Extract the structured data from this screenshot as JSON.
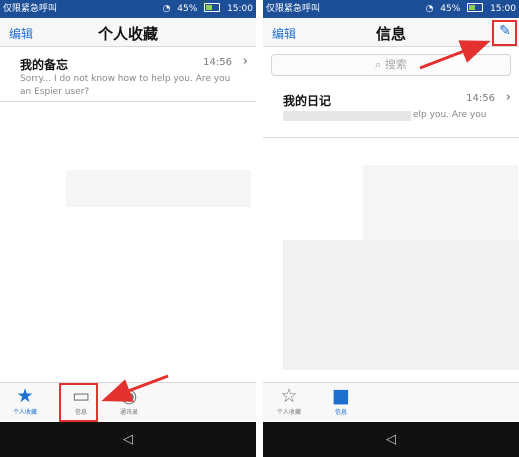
{
  "colors": {
    "status_bar": "#1c4f98",
    "accent": "#1f6fd1",
    "highlight": "#e53030",
    "nav_bar": "#111111"
  },
  "left_screen": {
    "status": {
      "carrier": "仅限紧急呼叫",
      "battery": "45%",
      "time": "15:00"
    },
    "nav": {
      "edit": "编辑",
      "title": "个人收藏"
    },
    "items": [
      {
        "title": "我的备忘",
        "time": "14:56",
        "snippet": "Sorry... I do not know how to help you. Are you an Espier user?"
      }
    ],
    "tabs": [
      {
        "label": "个人收藏",
        "icon": "star-filled-icon"
      },
      {
        "label": "信息",
        "icon": "chat-bubbles-icon"
      },
      {
        "label": "通讯录",
        "icon": "contacts-icon"
      }
    ],
    "system_nav": "◁"
  },
  "right_screen": {
    "status": {
      "carrier": "仅限紧急呼叫",
      "battery": "45%",
      "time": "15:00"
    },
    "nav": {
      "edit": "编辑",
      "title": "信息"
    },
    "search": {
      "placeholder": "搜索"
    },
    "items": [
      {
        "title": "我的日记",
        "time": "14:56",
        "snippet": "elp you. Are you"
      }
    ],
    "tabs": [
      {
        "label": "个人收藏",
        "icon": "star-outline-icon"
      },
      {
        "label": "信息",
        "icon": "chat-bubbles-filled-icon"
      }
    ],
    "system_nav": "◁"
  }
}
